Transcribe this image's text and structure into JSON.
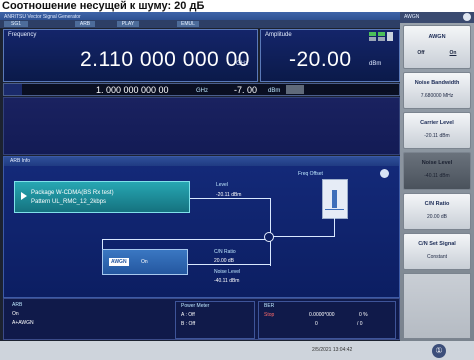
{
  "caption": "Соотношение несущей к шуму: 20 дБ",
  "window": {
    "title": "ANRITSU Vector Signal Generator",
    "tabs": [
      "SG1",
      "ARB",
      "PLAY",
      "EMUL"
    ]
  },
  "frequency": {
    "label": "Frequency",
    "value": "2.110 000 000 00",
    "unit": "GHz"
  },
  "amplitude": {
    "label": "Amplitude",
    "value": "-20.00",
    "unit": "dBm"
  },
  "sub_bar": {
    "freq": "1. 000 000 000 00",
    "freq_unit": "GHz",
    "amp": "-7. 00",
    "amp_unit": "dBm"
  },
  "arb": {
    "header": "ARB Info",
    "package": "Package  W-CDMA(BS Rx test)",
    "pattern": "Pattern   UL_RMC_12_2kbps",
    "level_label": "Level",
    "level_value": "-20.11 dBm",
    "freq_offset_label": "Freq Offset",
    "awgn_label": "AWGN",
    "awgn_state": "On",
    "cn_label": "C/N Ratio",
    "cn_value": "20.00 dB",
    "noise_label": "Noise Level",
    "noise_value": "-40.11 dBm"
  },
  "status": {
    "arb_label": "ARB",
    "arb_on": "On",
    "arb_mode": "A+AWGN",
    "power_meter": "Power Meter",
    "pm_a": "A :    Off",
    "pm_b": "B :    Off",
    "ber": "BER",
    "ber_state": "Stop",
    "ber_value": "0.0000*000",
    "ber_pct": "0 %",
    "ber_count": "0",
    "ber_slash": "/ 0"
  },
  "datetime": "2/5/2021 13:04:42",
  "right_panel": {
    "header": "AWGN",
    "awgn_title": "AWGN",
    "awgn_off": "Off",
    "awgn_on": "On",
    "noise_bw_label": "Noise Bandwidth",
    "noise_bw_value": "7.680000 MHz",
    "carrier_label": "Carrier Level",
    "carrier_value": "-20.11 dBm",
    "noise_level_label": "Noise Level",
    "noise_level_value": "-40.11 dBm",
    "cn_label": "C/N Ratio",
    "cn_value": "20.00 dB",
    "cn_set_label": "C/N Set Signal",
    "cn_set_value": "Constant"
  },
  "colors": {
    "accent": "#14256a",
    "package_box": "#1d8f9b",
    "awgn_box": "#2f67b2"
  }
}
